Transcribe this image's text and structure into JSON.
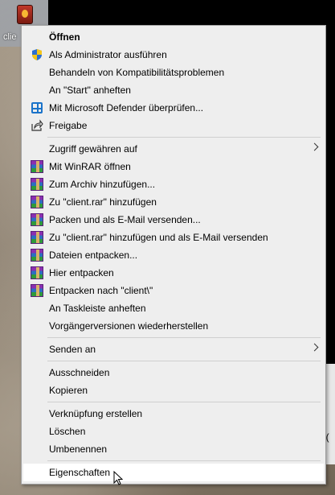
{
  "desktop": {
    "icon_label": "clie",
    "partial_right_text": "i("
  },
  "menu": {
    "items": [
      {
        "label": "Öffnen",
        "icon": "none",
        "bold": true
      },
      {
        "label": "Als Administrator ausführen",
        "icon": "uac-shield-icon"
      },
      {
        "label": "Behandeln von Kompatibilitätsproblemen",
        "icon": "none"
      },
      {
        "label": "An \"Start\" anheften",
        "icon": "none"
      },
      {
        "label": "Mit Microsoft Defender überprüfen...",
        "icon": "defender-icon"
      },
      {
        "label": "Freigabe",
        "icon": "share-icon"
      },
      {
        "label": "Zugriff gewähren auf",
        "icon": "none",
        "submenu": true
      },
      {
        "label": "Mit WinRAR öffnen",
        "icon": "winrar-icon"
      },
      {
        "label": "Zum Archiv hinzufügen...",
        "icon": "winrar-icon"
      },
      {
        "label": "Zu \"client.rar\" hinzufügen",
        "icon": "winrar-icon"
      },
      {
        "label": "Packen und als E-Mail versenden...",
        "icon": "winrar-icon"
      },
      {
        "label": "Zu \"client.rar\" hinzufügen und als E-Mail versenden",
        "icon": "winrar-icon"
      },
      {
        "label": "Dateien entpacken...",
        "icon": "winrar-icon"
      },
      {
        "label": "Hier entpacken",
        "icon": "winrar-icon"
      },
      {
        "label": "Entpacken nach \"client\\\"",
        "icon": "winrar-icon"
      },
      {
        "label": "An Taskleiste anheften",
        "icon": "none"
      },
      {
        "label": "Vorgängerversionen wiederherstellen",
        "icon": "none"
      },
      {
        "label": "Senden an",
        "icon": "none",
        "submenu": true
      },
      {
        "label": "Ausschneiden",
        "icon": "none"
      },
      {
        "label": "Kopieren",
        "icon": "none"
      },
      {
        "label": "Verknüpfung erstellen",
        "icon": "none"
      },
      {
        "label": "Löschen",
        "icon": "none"
      },
      {
        "label": "Umbenennen",
        "icon": "none"
      },
      {
        "label": "Eigenschaften",
        "icon": "none",
        "hovered": true
      }
    ]
  },
  "colors": {
    "menu_bg": "#eeeeee",
    "hover_bg": "#ffffff",
    "separator": "#cfcfcf",
    "defender_blue": "#1a73c9"
  }
}
